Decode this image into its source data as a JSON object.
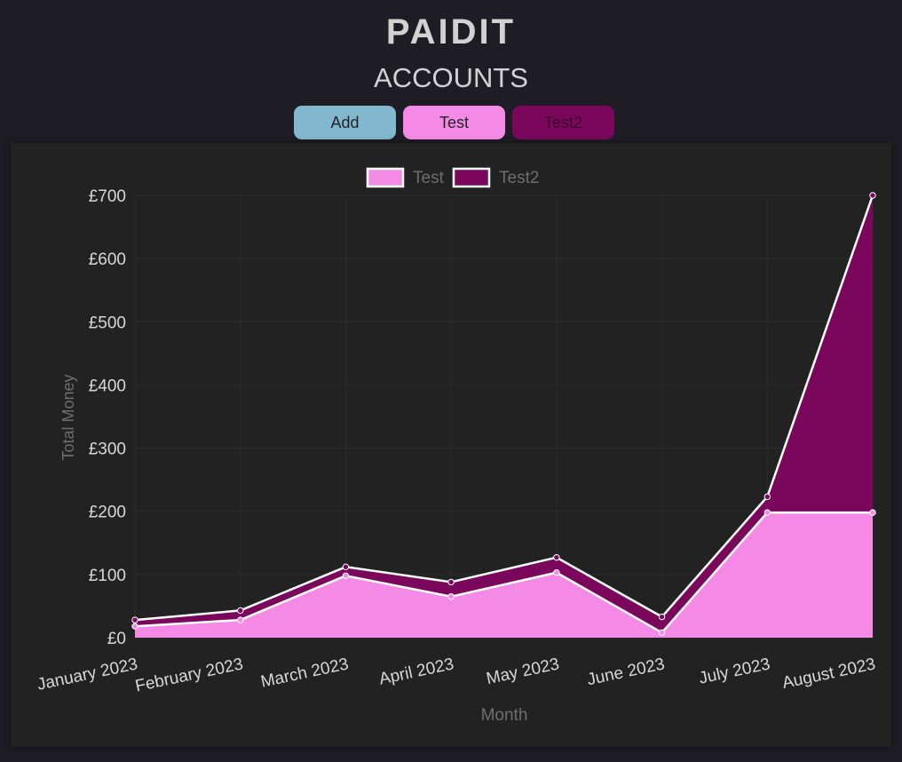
{
  "app": {
    "title": "PAIDIT",
    "page_title": "ACCOUNTS"
  },
  "toolbar": {
    "add_label": "Add",
    "test_label": "Test",
    "test2_label": "Test2"
  },
  "colors": {
    "background": "#1e1c25",
    "panel": "#222222",
    "add_button": "#82b8cf",
    "test": "#f58ae6",
    "test2": "#7a075c"
  },
  "chart_data": {
    "type": "area",
    "stacked": true,
    "categories": [
      "January 2023",
      "February 2023",
      "March 2023",
      "April 2023",
      "May 2023",
      "June 2023",
      "July 2023",
      "August 2023"
    ],
    "series": [
      {
        "name": "Test",
        "color": "#f58ae6",
        "values": [
          18,
          28,
          98,
          65,
          103,
          8,
          198,
          198
        ]
      },
      {
        "name": "Test2",
        "color": "#7a075c",
        "values": [
          10,
          15,
          14,
          23,
          24,
          25,
          25,
          502
        ]
      }
    ],
    "xlabel": "Month",
    "ylabel": "Total Money",
    "ylim": [
      0,
      700
    ],
    "yticks": [
      "£0",
      "£100",
      "£200",
      "£300",
      "£400",
      "£500",
      "£600",
      "£700"
    ],
    "legend_position": "top-center",
    "grid": true
  }
}
